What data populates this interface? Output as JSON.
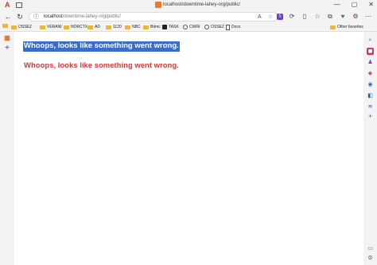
{
  "titlebar": {
    "tab_title": "localhost/downtime-lahey-org/public/",
    "minimize": "—",
    "maximize": "▢",
    "close": "✕"
  },
  "navigation": {
    "back": "←",
    "refresh": "↻",
    "url_host": "localhost",
    "url_path": "/downtime-lahey-org/public/"
  },
  "favorites": {
    "items": [
      {
        "label": "OSSEZ",
        "icon": "folder-icon"
      },
      {
        "label": "VERANI",
        "icon": "folder-icon"
      },
      {
        "label": "NORCTX",
        "icon": "folder-icon"
      },
      {
        "label": "AD",
        "icon": "folder-icon"
      },
      {
        "label": "1120",
        "icon": "folder-icon"
      },
      {
        "label": "NBC",
        "icon": "folder-icon"
      },
      {
        "label": "Bdmc",
        "icon": "folder-icon"
      },
      {
        "label": "TASK",
        "icon": "task-icon"
      },
      {
        "label": "CWRI",
        "icon": "circle-icon"
      },
      {
        "label": "OSSEZ",
        "icon": "circle-icon"
      },
      {
        "label": "Docs",
        "icon": "doc-icon"
      }
    ],
    "other_favorites": "Other favorites"
  },
  "content": {
    "error_selected": "Whoops, looks like something went wrong.",
    "error_message": "Whoops, looks like something went wrong."
  },
  "colors": {
    "error_red": "#d63a3a",
    "selection_blue": "#3b6cc6",
    "tab_favicon": "#f0782c"
  }
}
